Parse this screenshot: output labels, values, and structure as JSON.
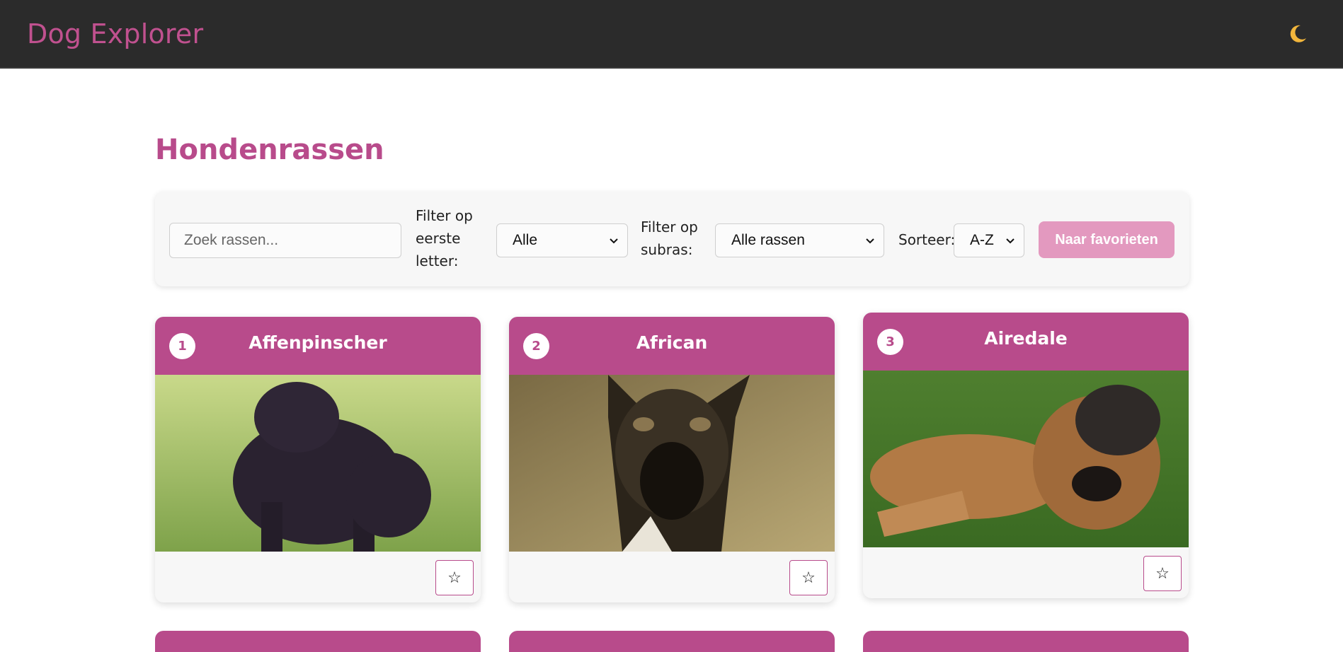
{
  "app": {
    "title": "Dog Explorer",
    "theme_icon": "moon-icon"
  },
  "page": {
    "title": "Hondenrassen"
  },
  "filters": {
    "search_placeholder": "Zoek rassen...",
    "letter_label_1": "Filter op",
    "letter_label_2": "eerste",
    "letter_label_3": "letter:",
    "letter_value": "Alle",
    "subbreed_label_1": "Filter op",
    "subbreed_label_2": "subras:",
    "subbreed_value": "Alle rassen",
    "sort_label": "Sorteer:",
    "sort_value": "A-Z",
    "favorites_button": "Naar favorieten"
  },
  "cards": [
    {
      "number": "1",
      "name": "Affenpinscher",
      "favorite_icon": "star-outline-icon"
    },
    {
      "number": "2",
      "name": "African",
      "favorite_icon": "star-outline-icon"
    },
    {
      "number": "3",
      "name": "Airedale",
      "favorite_icon": "star-outline-icon"
    }
  ],
  "colors": {
    "accent": "#b84b8b",
    "header_bg": "#2b2b2b",
    "favorites_button_bg": "#e399bf"
  }
}
